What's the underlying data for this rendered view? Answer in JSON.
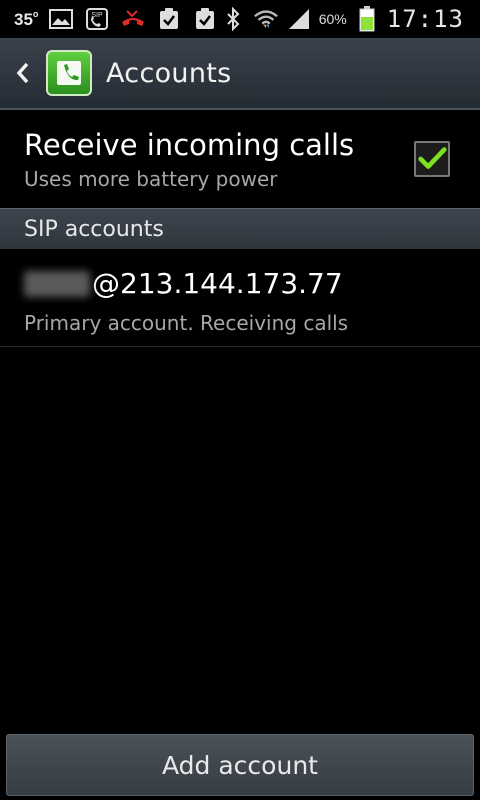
{
  "status_bar": {
    "temperature": "35",
    "battery_percent": "60%",
    "time": "17:13",
    "battery_level": 0.6,
    "icons": [
      "gallery-icon",
      "sip-call-icon",
      "missed-call-icon",
      "task-icon",
      "task-icon",
      "bluetooth-icon",
      "wifi-icon",
      "signal-icon",
      "battery-icon"
    ]
  },
  "action_bar": {
    "title": "Accounts"
  },
  "receive_calls": {
    "title": "Receive incoming calls",
    "summary": "Uses more battery power",
    "checked": true
  },
  "sip_section": {
    "header": "SIP accounts",
    "account": {
      "address": "@213.144.173.77",
      "summary": "Primary account. Receiving calls"
    }
  },
  "footer": {
    "add_account_label": "Add account"
  },
  "colors": {
    "checkmark": "#7ee022",
    "battery": "#8ee03a",
    "app_icon": "#3fae2a"
  }
}
